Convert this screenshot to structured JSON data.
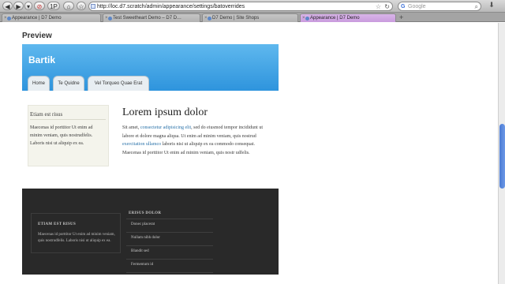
{
  "browser": {
    "nav": {
      "back": "◀",
      "forward": "▶",
      "reload_menu": "▾",
      "stop": "⊘",
      "onepass": "1P"
    },
    "url": "http://loc.d7.scratch/admin/appearance/settings/batoverrides",
    "search_placeholder": "Google",
    "tabs": [
      {
        "label": "Appearance | D7 Demo",
        "active": false
      },
      {
        "label": "Test Sweetheart Demo – D7 D…",
        "active": false
      },
      {
        "label": "D7 Demo | Site Shops",
        "active": false
      },
      {
        "label": "Appearance | D7 Demo",
        "active": true
      }
    ],
    "new_tab": "+"
  },
  "preview": {
    "heading": "Preview",
    "site_name": "Bartik",
    "menu": [
      "Home",
      "Te Quidne",
      "Vel Torqueo Quae Erat"
    ],
    "sidebar": {
      "title": "Etiam est risus",
      "text": "Maecenas id porttitor Ut enim ad minim veniam, quis nostrudfelis. Laboris nisi ut aliquip ex ea."
    },
    "main": {
      "title": "Lorem ipsum dolor",
      "text_1": "Sit amet, ",
      "link_1": "consectetur adipisicing elit",
      "text_2": ", sed do eiusmod tempor incididunt ut labore et dolore magna aliqua. Ut enim ad minim veniam, quis nostrud ",
      "link_2": "exercitation ullamco",
      "text_3": " laboris nisi ut aliquip ex ea commodo consequat. Maecenas id porttitor Ut enim ad minim veniam, quis nostr udfelis."
    },
    "footer": {
      "block_title": "ETIAM EST RISUS",
      "block_text": "Maecenas id porttitor Ut enim ad minim veniam, quis nostrudfelis. Laboris nisi ut aliquip ex ea.",
      "menu_title": "ERISUS DOLOR",
      "menu_items": [
        "Donec placerat",
        "Nullam nibh dolor",
        "Blandit sed",
        "Fermentum id"
      ]
    }
  },
  "colors": {
    "header_top": "#5fb8ee",
    "header_bottom": "#2e94dd",
    "footer_bg": "#292929",
    "link": "#2a72a9",
    "sidebar_bg": "#f4f4ec"
  }
}
